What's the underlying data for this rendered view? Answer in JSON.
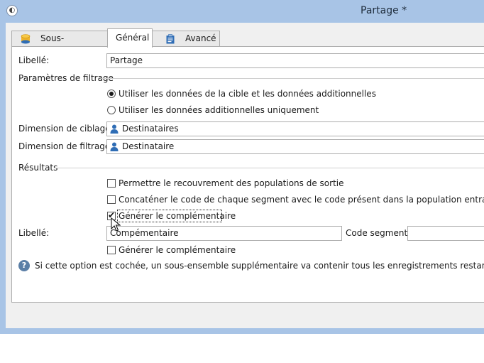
{
  "window": {
    "title": "Partage *"
  },
  "tabs": [
    {
      "label": "Sous-ensembles",
      "icon": "database-icon",
      "active": false
    },
    {
      "label": "Général",
      "icon": "",
      "active": true
    },
    {
      "label": "Avancé",
      "icon": "clipboard-icon",
      "active": false
    }
  ],
  "general": {
    "libelle_label": "Libellé:",
    "libelle_value": "Partage",
    "filter_section": "Paramètres de filtrage",
    "radio_options": [
      {
        "label": "Utiliser les données de la cible et les données additionnelles",
        "selected": true
      },
      {
        "label": "Utiliser les données additionnelles uniquement",
        "selected": false
      }
    ],
    "targeting_dimension_label": "Dimension de ciblage:",
    "targeting_dimension_value": "Destinataires",
    "filtering_dimension_label": "Dimension de filtrage:",
    "filtering_dimension_value": "Destinataire",
    "results_section": "Résultats",
    "checkboxes": [
      {
        "label": "Permettre le recouvrement des populations de sortie",
        "checked": false
      },
      {
        "label": "Concaténer le code de chaque segment avec le code présent dans la population entrante",
        "checked": false
      },
      {
        "label": "Générer le complémentaire",
        "checked": true
      }
    ],
    "complement_libelle_label": "Libellé:",
    "complement_libelle_value": "Compémentaire",
    "segment_code_label": "Code segment:",
    "segment_code_value": "",
    "second_complement_label": "Générer le complémentaire",
    "second_complement_checked": false,
    "help_text": "Si cette option est cochée, un sous-ensemble supplémentaire va contenir tous les enregistrements restants."
  },
  "colors": {
    "window_frame": "#a8c4e6",
    "panel_bg": "#ffffff",
    "dialog_bg": "#f0f0f0",
    "icon_blue": "#2f6db5"
  }
}
